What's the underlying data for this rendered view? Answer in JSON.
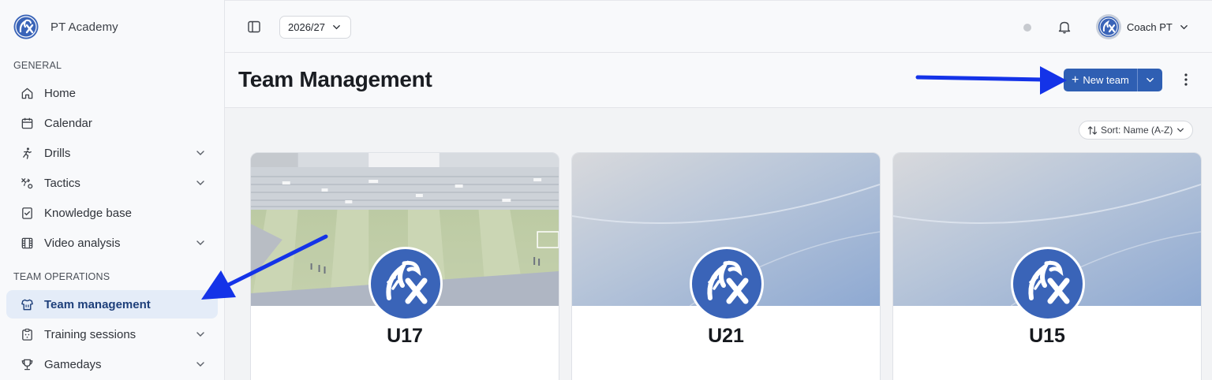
{
  "app": {
    "name": "PT Academy"
  },
  "sidebar": {
    "general_label": "GENERAL",
    "general_items": [
      {
        "label": "Home",
        "icon": "home-icon"
      },
      {
        "label": "Calendar",
        "icon": "calendar-icon"
      },
      {
        "label": "Drills",
        "icon": "running-icon",
        "expandable": true
      },
      {
        "label": "Tactics",
        "icon": "tactics-icon",
        "expandable": true
      },
      {
        "label": "Knowledge base",
        "icon": "knowledge-icon"
      },
      {
        "label": "Video analysis",
        "icon": "film-icon",
        "expandable": true
      }
    ],
    "team_ops_label": "TEAM OPERATIONS",
    "team_ops_items": [
      {
        "label": "Team management",
        "icon": "shirt-icon",
        "active": true
      },
      {
        "label": "Training sessions",
        "icon": "clipboard-icon",
        "expandable": true
      },
      {
        "label": "Gamedays",
        "icon": "trophy-icon",
        "expandable": true
      }
    ]
  },
  "topbar": {
    "season": "2026/27",
    "user_name": "Coach PT"
  },
  "page": {
    "title": "Team Management",
    "new_team_label": "New team",
    "sort_label": "Sort: Name (A-Z)"
  },
  "teams": [
    {
      "name": "U17",
      "banner": "stadium-photo"
    },
    {
      "name": "U21",
      "banner": "blue-gradient"
    },
    {
      "name": "U15",
      "banner": "blue-gradient"
    }
  ],
  "colors": {
    "accent": "#2f5fb3",
    "active_bg": "#e4ecf8",
    "arrow": "#1433e8"
  }
}
